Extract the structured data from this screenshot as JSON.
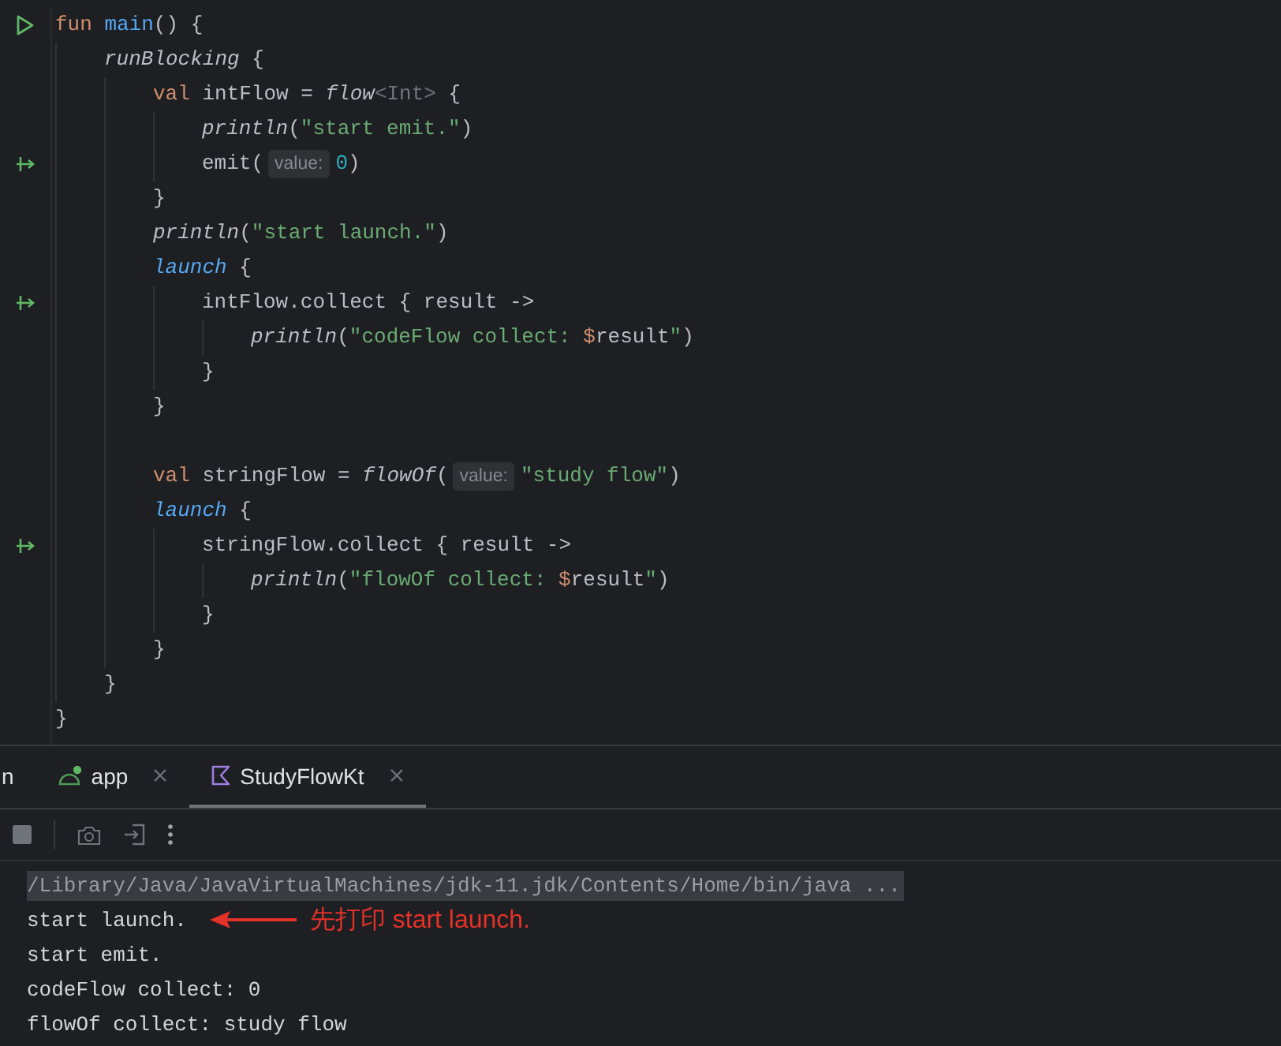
{
  "editor": {
    "lines": [
      {
        "runnable": true,
        "tokens": [
          {
            "kind": "kw",
            "text": "fun"
          },
          {
            "kind": "fn",
            "text": " main"
          },
          {
            "kind": "plain",
            "text": "() {"
          }
        ],
        "children": [
          {
            "tokens": [
              {
                "kind": "call",
                "text": "runBlocking"
              },
              {
                "kind": "plain",
                "text": " {"
              }
            ],
            "children": [
              {
                "tokens": [
                  {
                    "kind": "kw",
                    "text": "val"
                  },
                  {
                    "kind": "plain",
                    "text": " intFlow = "
                  },
                  {
                    "kind": "call",
                    "text": "flow"
                  },
                  {
                    "kind": "type",
                    "text": "<Int>"
                  },
                  {
                    "kind": "plain",
                    "text": " {"
                  }
                ],
                "children": [
                  {
                    "tokens": [
                      {
                        "kind": "call",
                        "text": "println"
                      },
                      {
                        "kind": "plain",
                        "text": "("
                      },
                      {
                        "kind": "str",
                        "text": "\"start emit.\""
                      },
                      {
                        "kind": "plain",
                        "text": ")"
                      }
                    ]
                  },
                  {
                    "suspend_point": true,
                    "tokens": [
                      {
                        "kind": "plain",
                        "text": "emit("
                      },
                      {
                        "kind": "hint",
                        "text": "value:"
                      },
                      {
                        "kind": "num",
                        "text": "0"
                      },
                      {
                        "kind": "plain",
                        "text": ")"
                      }
                    ]
                  }
                ]
              },
              {
                "tokens": [
                  {
                    "kind": "plain",
                    "text": "}"
                  }
                ]
              },
              {
                "tokens": [
                  {
                    "kind": "call",
                    "text": "println"
                  },
                  {
                    "kind": "plain",
                    "text": "("
                  },
                  {
                    "kind": "str",
                    "text": "\"start launch.\""
                  },
                  {
                    "kind": "plain",
                    "text": ")"
                  }
                ]
              },
              {
                "tokens": [
                  {
                    "kind": "callb",
                    "text": "launch"
                  },
                  {
                    "kind": "plain",
                    "text": " {"
                  }
                ],
                "children": [
                  {
                    "suspend_point": true,
                    "tokens": [
                      {
                        "kind": "plain",
                        "text": "intFlow.collect { result ->"
                      }
                    ],
                    "children": [
                      {
                        "tokens": [
                          {
                            "kind": "call",
                            "text": "println"
                          },
                          {
                            "kind": "plain",
                            "text": "("
                          },
                          {
                            "kind": "str",
                            "text": "\"codeFlow collect: "
                          },
                          {
                            "kind": "tmpl",
                            "text": "$"
                          },
                          {
                            "kind": "plain",
                            "text": "result"
                          },
                          {
                            "kind": "str",
                            "text": "\""
                          },
                          {
                            "kind": "plain",
                            "text": ")"
                          }
                        ]
                      }
                    ]
                  },
                  {
                    "tokens": [
                      {
                        "kind": "plain",
                        "text": "}"
                      }
                    ]
                  }
                ]
              },
              {
                "tokens": [
                  {
                    "kind": "plain",
                    "text": "}"
                  }
                ]
              },
              {
                "blank": true
              },
              {
                "tokens": [
                  {
                    "kind": "kw",
                    "text": "val"
                  },
                  {
                    "kind": "plain",
                    "text": " stringFlow = "
                  },
                  {
                    "kind": "call",
                    "text": "flowOf"
                  },
                  {
                    "kind": "plain",
                    "text": "("
                  },
                  {
                    "kind": "hint",
                    "text": "value:"
                  },
                  {
                    "kind": "str",
                    "text": "\"study flow\""
                  },
                  {
                    "kind": "plain",
                    "text": ")"
                  }
                ]
              },
              {
                "tokens": [
                  {
                    "kind": "callb",
                    "text": "launch"
                  },
                  {
                    "kind": "plain",
                    "text": " {"
                  }
                ],
                "children": [
                  {
                    "suspend_point": true,
                    "tokens": [
                      {
                        "kind": "plain",
                        "text": "stringFlow.collect { result ->"
                      }
                    ],
                    "children": [
                      {
                        "tokens": [
                          {
                            "kind": "call",
                            "text": "println"
                          },
                          {
                            "kind": "plain",
                            "text": "("
                          },
                          {
                            "kind": "str",
                            "text": "\"flowOf collect: "
                          },
                          {
                            "kind": "tmpl",
                            "text": "$"
                          },
                          {
                            "kind": "plain",
                            "text": "result"
                          },
                          {
                            "kind": "str",
                            "text": "\""
                          },
                          {
                            "kind": "plain",
                            "text": ")"
                          }
                        ]
                      }
                    ]
                  },
                  {
                    "tokens": [
                      {
                        "kind": "plain",
                        "text": "}"
                      }
                    ]
                  }
                ]
              },
              {
                "tokens": [
                  {
                    "kind": "plain",
                    "text": "}"
                  }
                ]
              }
            ]
          },
          {
            "tokens": [
              {
                "kind": "plain",
                "text": "}"
              }
            ]
          }
        ]
      },
      {
        "tokens": [
          {
            "kind": "plain",
            "text": "}"
          }
        ]
      }
    ]
  },
  "run_panel": {
    "tabs": [
      {
        "kind": "partial",
        "label": "n",
        "selected": false
      },
      {
        "kind": "module",
        "label": "app",
        "selected": false
      },
      {
        "kind": "file",
        "label": "StudyFlowKt",
        "selected": true
      }
    ],
    "console": [
      {
        "kind": "command",
        "text": "/Library/Java/JavaVirtualMachines/jdk-11.jdk/Contents/Home/bin/java ..."
      },
      {
        "kind": "output",
        "text": "start launch.",
        "annotation": "先打印 start launch."
      },
      {
        "kind": "output",
        "text": "start emit."
      },
      {
        "kind": "output",
        "text": "codeFlow collect: 0"
      },
      {
        "kind": "output",
        "text": "flowOf collect: study flow"
      }
    ]
  }
}
